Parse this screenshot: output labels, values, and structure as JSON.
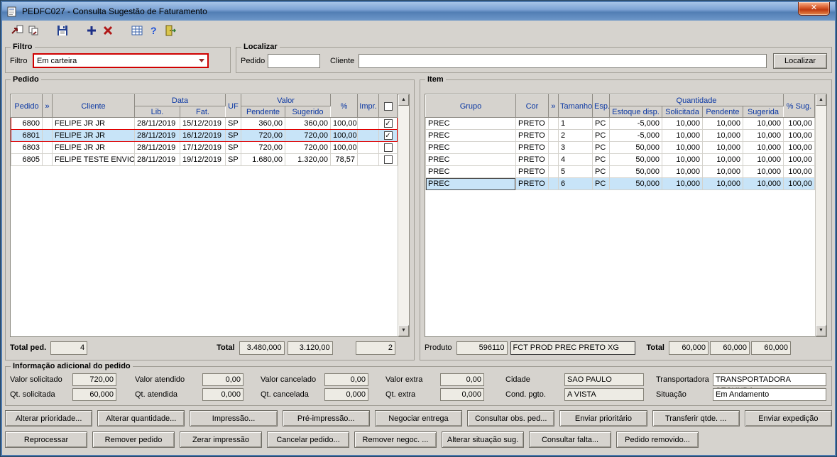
{
  "window": {
    "title": "PEDFC027 - Consulta Sugestão de Faturamento",
    "close_glyph": "✕"
  },
  "toolbar": {
    "icons": [
      "transfer",
      "copy",
      "save",
      "add",
      "delete",
      "grid",
      "help",
      "exit"
    ]
  },
  "filtro": {
    "legend": "Filtro",
    "label": "Filtro",
    "value": "Em carteira"
  },
  "localizar": {
    "legend": "Localizar",
    "pedido_label": "Pedido",
    "pedido_value": "",
    "cliente_label": "Cliente",
    "cliente_value": "",
    "button": "Localizar"
  },
  "pedido": {
    "legend": "Pedido",
    "h": {
      "pedido": "Pedido",
      "arrows": "»",
      "cliente": "Cliente",
      "data": "Data",
      "lib": "Lib.",
      "fat": "Fat.",
      "uf": "UF",
      "valor": "Valor",
      "pendente": "Pendente",
      "sugerido": "Sugerido",
      "pct": "%",
      "impr": "Impr."
    },
    "rows": [
      {
        "pedido": "6800",
        "cliente": "FELIPE JR JR",
        "lib": "28/11/2019",
        "fat": "15/12/2019",
        "uf": "SP",
        "pendente": "360,00",
        "sugerido": "360,00",
        "pct": "100,00",
        "check": "✓"
      },
      {
        "pedido": "6801",
        "cliente": "FELIPE JR JR",
        "lib": "28/11/2019",
        "fat": "16/12/2019",
        "uf": "SP",
        "pendente": "720,00",
        "sugerido": "720,00",
        "pct": "100,00",
        "check": "✓"
      },
      {
        "pedido": "6803",
        "cliente": "FELIPE JR JR",
        "lib": "28/11/2019",
        "fat": "17/12/2019",
        "uf": "SP",
        "pendente": "720,00",
        "sugerido": "720,00",
        "pct": "100,00",
        "check": ""
      },
      {
        "pedido": "6805",
        "cliente": "FELIPE TESTE ENVIO C",
        "lib": "28/11/2019",
        "fat": "19/12/2019",
        "uf": "SP",
        "pendente": "1.680,00",
        "sugerido": "1.320,00",
        "pct": "78,57",
        "check": ""
      }
    ],
    "totals": {
      "total_ped_label": "Total ped.",
      "total_ped": "4",
      "total_label": "Total",
      "pendente": "3.480,000",
      "sugerido": "3.120,00",
      "marked": "2"
    }
  },
  "item": {
    "legend": "Item",
    "h": {
      "grupo": "Grupo",
      "cor": "Cor",
      "arrows": "»",
      "tamanho": "Tamanho",
      "esp": "Esp.",
      "quantidade": "Quantidade",
      "estoque": "Estoque disp.",
      "solicitada": "Solicitada",
      "pendente": "Pendente",
      "sugerida": "Sugerida",
      "pct": "% Sug."
    },
    "rows": [
      {
        "grupo": "PREC",
        "cor": "PRETO",
        "tamanho": "1",
        "esp": "PC",
        "estoque": "-5,000",
        "solicitada": "10,000",
        "pendente": "10,000",
        "sugerida": "10,000",
        "pct": "100,00"
      },
      {
        "grupo": "PREC",
        "cor": "PRETO",
        "tamanho": "2",
        "esp": "PC",
        "estoque": "-5,000",
        "solicitada": "10,000",
        "pendente": "10,000",
        "sugerida": "10,000",
        "pct": "100,00"
      },
      {
        "grupo": "PREC",
        "cor": "PRETO",
        "tamanho": "3",
        "esp": "PC",
        "estoque": "50,000",
        "solicitada": "10,000",
        "pendente": "10,000",
        "sugerida": "10,000",
        "pct": "100,00"
      },
      {
        "grupo": "PREC",
        "cor": "PRETO",
        "tamanho": "4",
        "esp": "PC",
        "estoque": "50,000",
        "solicitada": "10,000",
        "pendente": "10,000",
        "sugerida": "10,000",
        "pct": "100,00"
      },
      {
        "grupo": "PREC",
        "cor": "PRETO",
        "tamanho": "5",
        "esp": "PC",
        "estoque": "50,000",
        "solicitada": "10,000",
        "pendente": "10,000",
        "sugerida": "10,000",
        "pct": "100,00"
      },
      {
        "grupo": "PREC",
        "cor": "PRETO",
        "tamanho": "6",
        "esp": "PC",
        "estoque": "50,000",
        "solicitada": "10,000",
        "pendente": "10,000",
        "sugerida": "10,000",
        "pct": "100,00"
      }
    ],
    "totals": {
      "produto_label": "Produto",
      "produto_code": "596110",
      "produto_desc": "FCT PROD PREC PRETO XG",
      "total_label": "Total",
      "solicitada": "60,000",
      "pendente": "60,000",
      "sugerida": "60,000"
    }
  },
  "info": {
    "legend": "Informação adicional do pedido",
    "row1": [
      {
        "label": "Valor solicitado",
        "value": "720,00"
      },
      {
        "label": "Valor atendido",
        "value": "0,00"
      },
      {
        "label": "Valor cancelado",
        "value": "0,00"
      },
      {
        "label": "Valor extra",
        "value": "0,00"
      },
      {
        "label": "Cidade",
        "value": "SAO PAULO"
      },
      {
        "label": "Transportadora",
        "value": "TRANSPORTADORA SECUNDA"
      }
    ],
    "row2": [
      {
        "label": "Qt. solicitada",
        "value": "60,000"
      },
      {
        "label": "Qt. atendida",
        "value": "0,000"
      },
      {
        "label": "Qt. cancelada",
        "value": "0,000"
      },
      {
        "label": "Qt. extra",
        "value": "0,000"
      },
      {
        "label": "Cond. pgto.",
        "value": "A VISTA"
      },
      {
        "label": "Situação",
        "value": "Em Andamento"
      }
    ]
  },
  "actions": {
    "row1": [
      "Alterar prioridade...",
      "Alterar quantidade...",
      "Impressão...",
      "Pré-impressão...",
      "Negociar entrega",
      "Consultar obs. ped...",
      "Enviar prioritário",
      "Transferir qtde. ...",
      "Enviar expedição"
    ],
    "row2": [
      "Reprocessar",
      "Remover pedido",
      "Zerar impressão",
      "Cancelar pedido...",
      "Remover negoc. ...",
      "Alterar situação sug.",
      "Consultar falta...",
      "Pedido removido..."
    ]
  }
}
